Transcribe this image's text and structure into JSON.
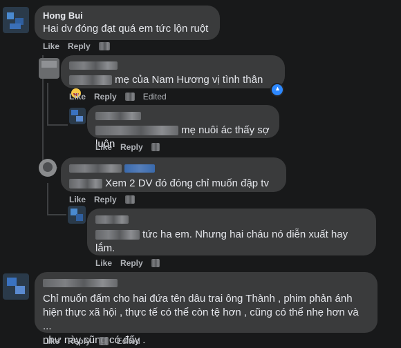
{
  "actions": {
    "like": "Like",
    "reply": "Reply",
    "edited": "Edited"
  },
  "comments": [
    {
      "author": "Hong Bui",
      "text": "Hai dv đóng đạt quá em tức lộn ruột"
    },
    {
      "text": "mẹ của Nam Hương vị tình thân",
      "reaction": "like"
    },
    {
      "text": "mẹ nuôi ác thấy sợ luôn"
    },
    {
      "text": "Xem 2 DV đó đóng chỉ muốn đập tv"
    },
    {
      "text_line1": "tức ha em. Nhưng hai cháu nó diễn xuất hay",
      "text_line2": "lắm."
    },
    {
      "lines": [
        "Chỉ muốn đấm cho hai đứa tên dâu trai ông Thành , phim phản ánh",
        "hiện thực xã hội , thực tế có thể còn tệ hơn , cũng có thể nhẹ hơn và ...",
        "như này cũng có đấy ."
      ]
    }
  ]
}
